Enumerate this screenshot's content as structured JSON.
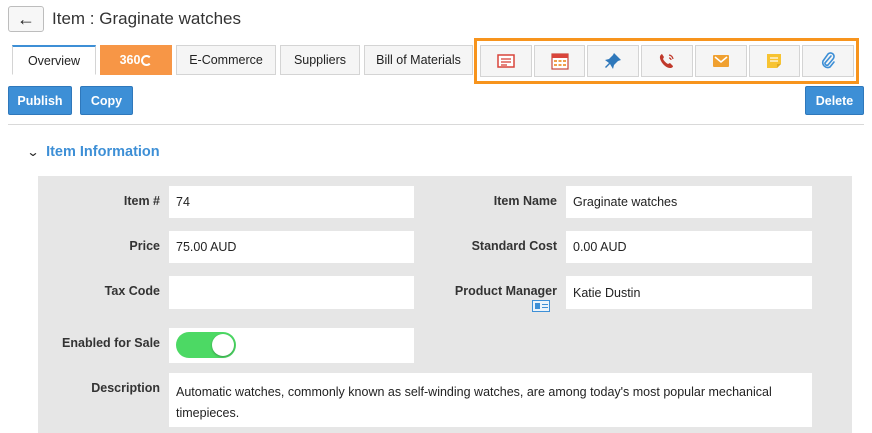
{
  "header": {
    "back_icon": "arrow-left-icon",
    "title": "Item : Graginate watches"
  },
  "tabs": [
    {
      "label": "Overview"
    },
    {
      "label": "360"
    },
    {
      "label": "E-Commerce"
    },
    {
      "label": "Suppliers"
    },
    {
      "label": "Bill of Materials"
    }
  ],
  "icon_tabs": [
    "document-icon",
    "calendar-icon",
    "pin-icon",
    "phone-icon",
    "mail-icon",
    "note-icon",
    "paperclip-icon"
  ],
  "toolbar": {
    "publish_label": "Publish",
    "copy_label": "Copy",
    "delete_label": "Delete"
  },
  "section": {
    "title": "Item Information"
  },
  "fields": {
    "item_no": {
      "label": "Item #",
      "value": "74"
    },
    "item_name": {
      "label": "Item Name",
      "value": "Graginate watches"
    },
    "price": {
      "label": "Price",
      "value": "75.00  AUD"
    },
    "standard_cost": {
      "label": "Standard Cost",
      "value": "0.00  AUD"
    },
    "tax_code": {
      "label": "Tax Code",
      "value": ""
    },
    "product_manager": {
      "label": "Product Manager",
      "value": "Katie Dustin"
    },
    "enabled_for_sale": {
      "label": "Enabled for Sale",
      "value": true
    },
    "description": {
      "label": "Description",
      "value": "Automatic watches, commonly known as self-winding watches, are among today's most popular mechanical timepieces."
    }
  },
  "colors": {
    "accent": "#3d8fd6",
    "tab_360": "#f79646",
    "highlight": "#f7941d",
    "toggle_on": "#4cd964",
    "panel": "#e6e6e6"
  }
}
